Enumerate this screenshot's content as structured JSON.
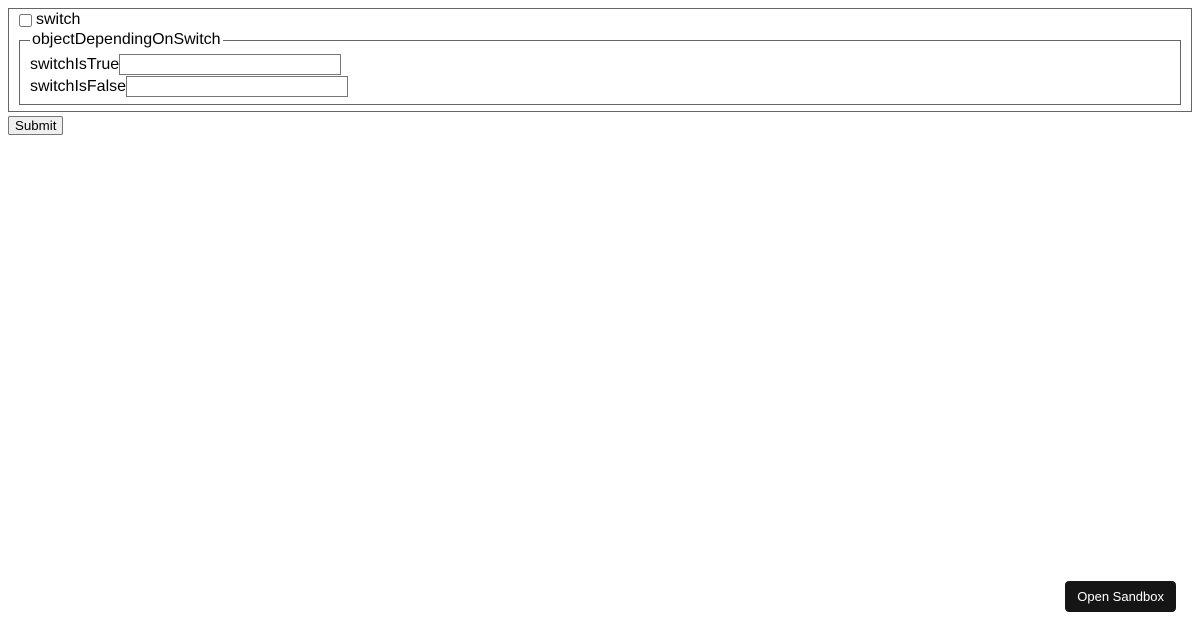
{
  "form": {
    "switch_label": "switch",
    "switch_checked": false,
    "group_legend": "objectDependingOnSwitch",
    "fields": [
      {
        "label": "switchIsTrue",
        "value": ""
      },
      {
        "label": "switchIsFalse",
        "value": ""
      }
    ],
    "submit_label": "Submit"
  },
  "sandbox_button_label": "Open Sandbox"
}
